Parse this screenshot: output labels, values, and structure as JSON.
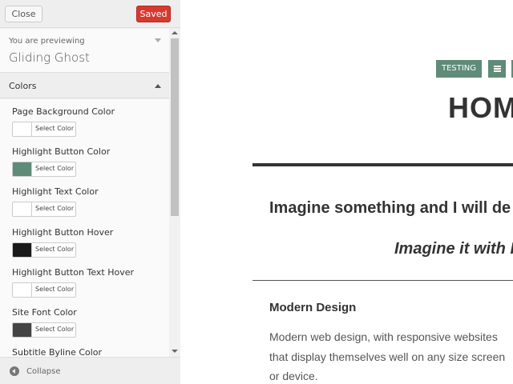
{
  "sidebar": {
    "close_label": "Close",
    "save_label": "Saved",
    "save_color": "#d63a2f",
    "previewing_label": "You are previewing",
    "theme_name": "Gliding Ghost",
    "section_label": "Colors",
    "collapse_label": "Collapse",
    "picker_label": "Select Color",
    "controls": [
      {
        "label": "Page Background Color",
        "swatch": "#ffffff"
      },
      {
        "label": "Highlight Button Color",
        "swatch": "#5f8b79"
      },
      {
        "label": "Highlight Text Color",
        "swatch": "#ffffff"
      },
      {
        "label": "Highlight Button Hover",
        "swatch": "#1a1a1a"
      },
      {
        "label": "Highlight Button Text Hover",
        "swatch": "#ffffff"
      },
      {
        "label": "Site Font Color",
        "swatch": "#444444"
      },
      {
        "label": "Subtitle Byline Color",
        "swatch": "#ffffff"
      }
    ]
  },
  "site": {
    "nav_testing": "TESTING",
    "nav_menu_icon": "hamburger-icon",
    "accent_color": "#5f8b79",
    "page_title": "HOM",
    "heading_1": "Imagine something and I will de",
    "heading_2": "Imagine it with I",
    "section_title": "Modern Design",
    "body_lines": [
      "Modern web design, with responsive websites",
      "that display themselves well on any size screen",
      "or device."
    ]
  }
}
